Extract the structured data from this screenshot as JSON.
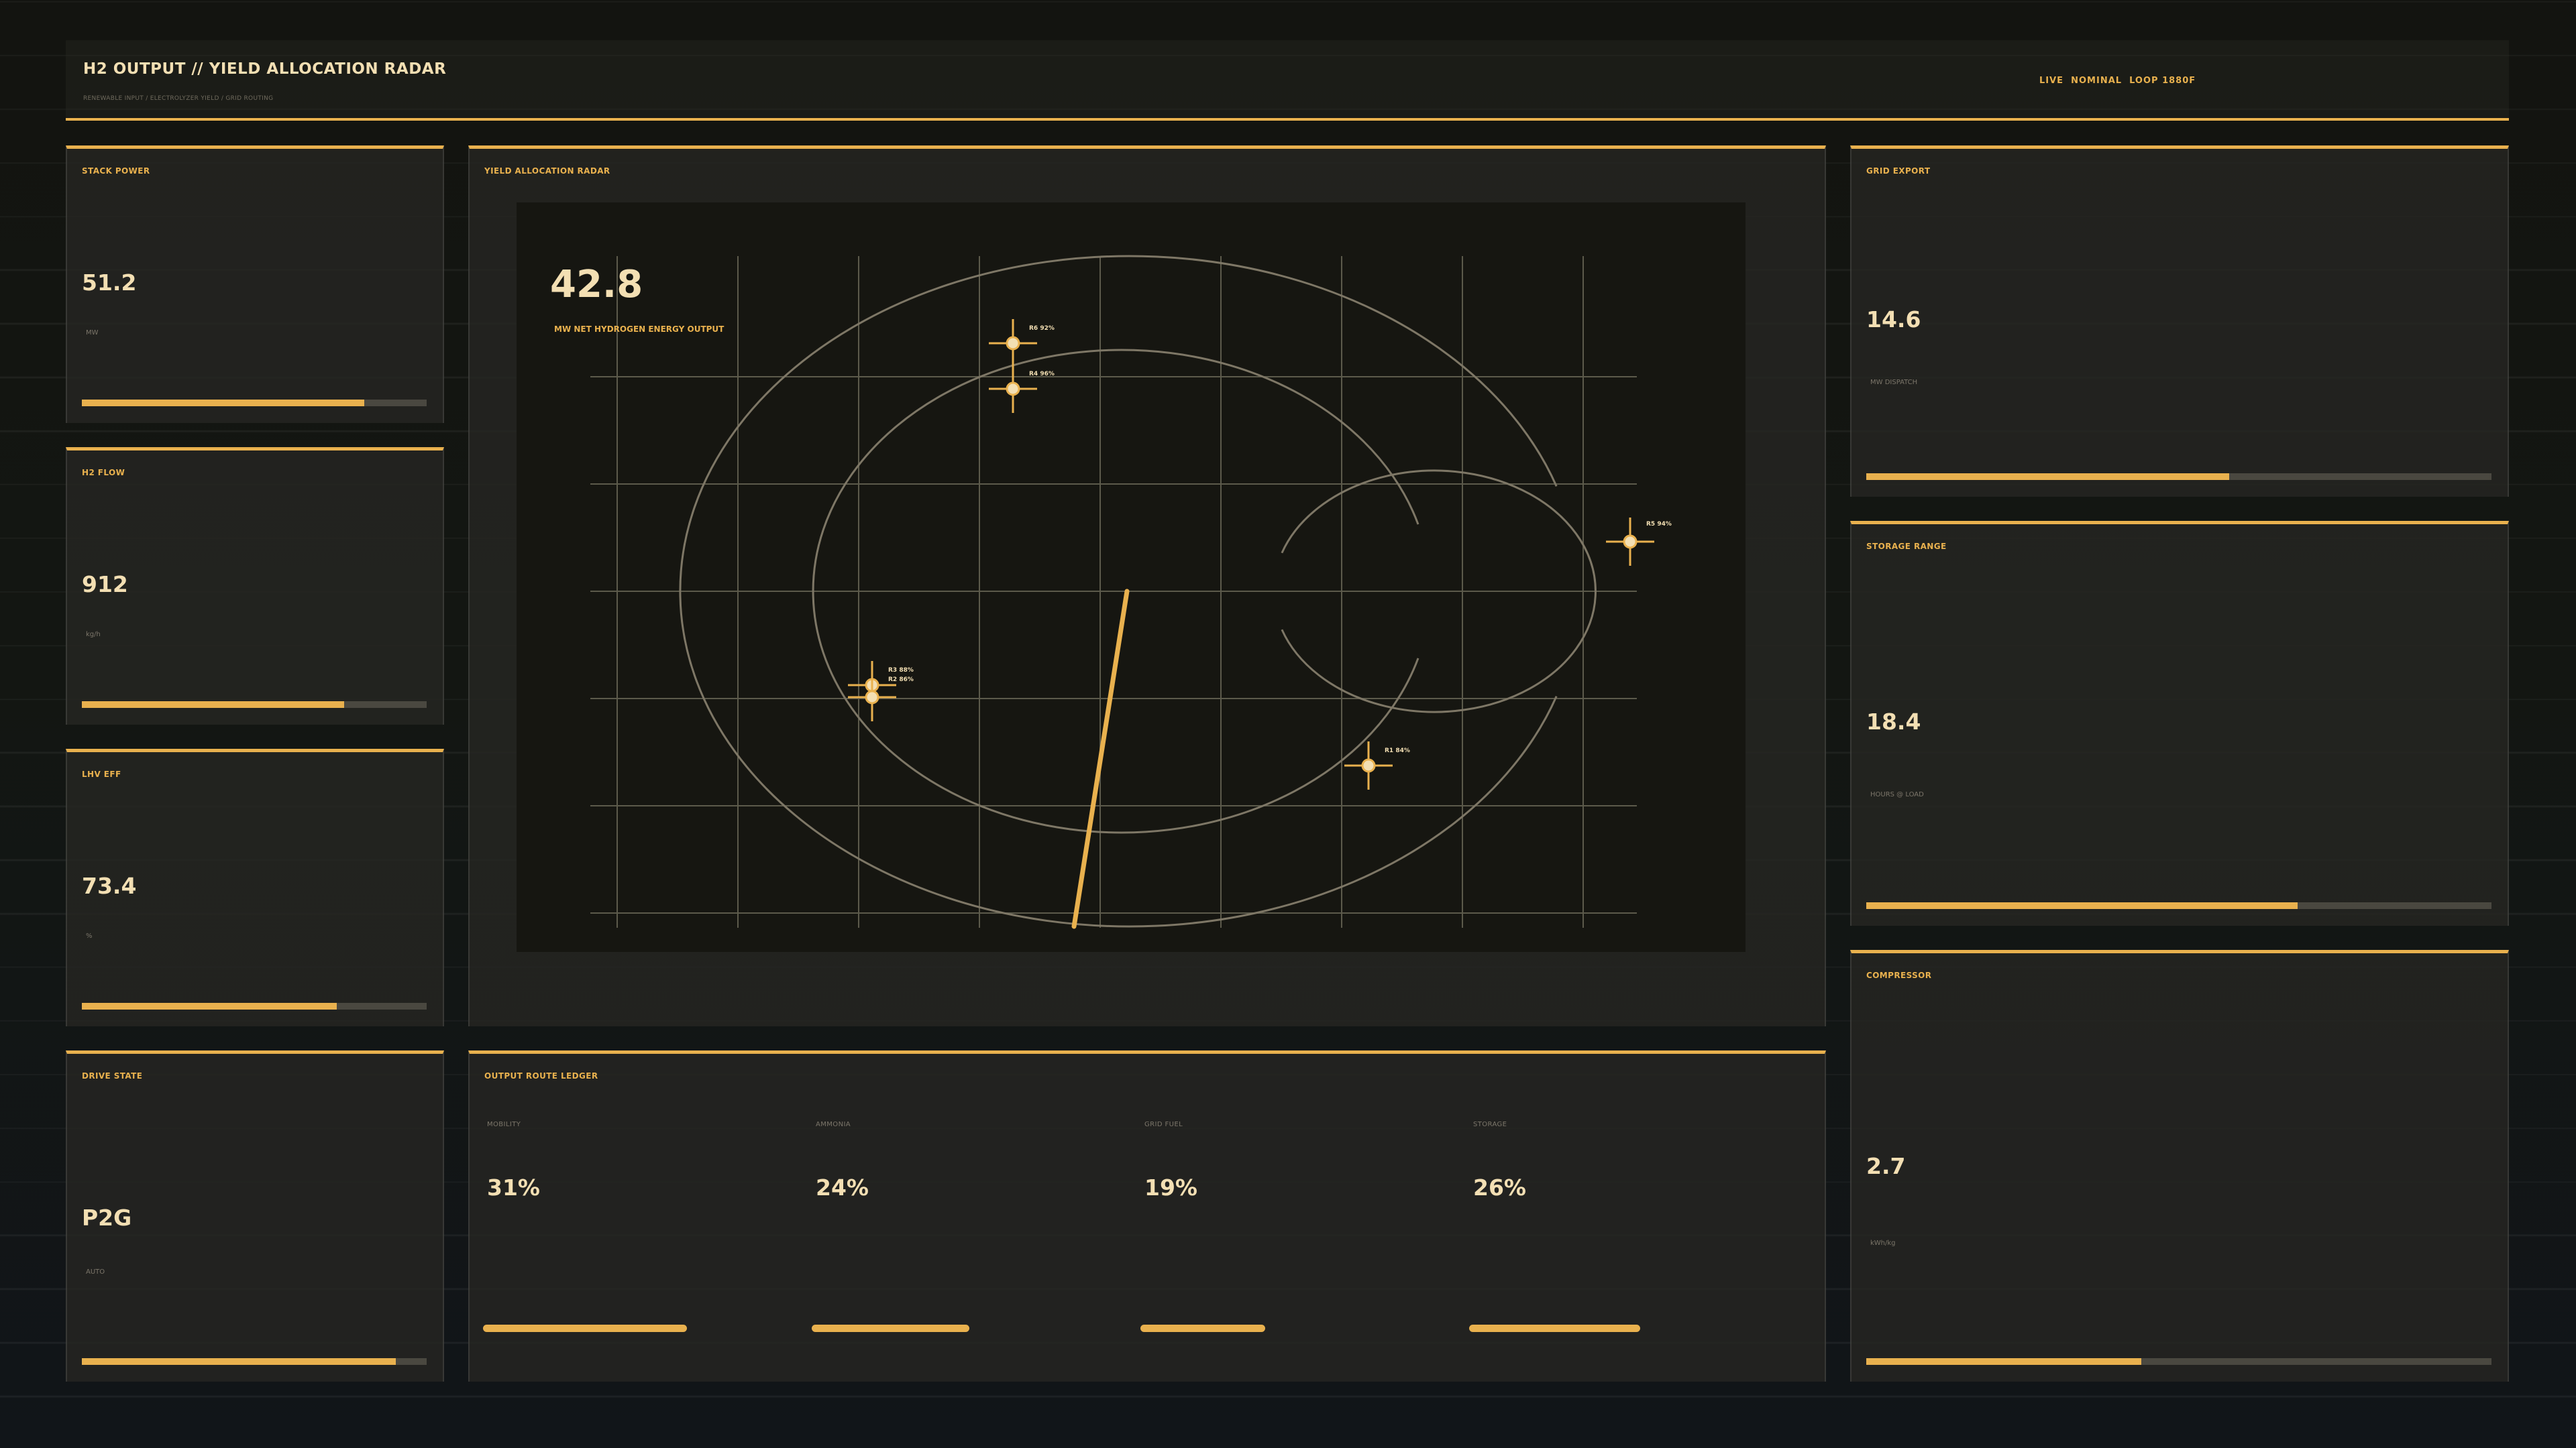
{
  "header": {
    "title": "H2 OUTPUT // YIELD ALLOCATION RADAR",
    "subtitle": "RENEWABLE INPUT / ELECTROLYZER YIELD / GRID ROUTING",
    "status": "LIVE  NOMINAL  LOOP 1880F"
  },
  "left_panels": [
    {
      "title": "STACK POWER",
      "value": "51.2",
      "unit": "MW",
      "fill": 0.82
    },
    {
      "title": "H2 FLOW",
      "value": "912",
      "unit": "kg/h",
      "fill": 0.76
    },
    {
      "title": "LHV EFF",
      "value": "73.4",
      "unit": "%",
      "fill": 0.74
    },
    {
      "title": "DRIVE STATE",
      "value": "P2G",
      "unit": "AUTO",
      "fill": 0.91
    }
  ],
  "radar": {
    "title": "YIELD ALLOCATION RADAR",
    "value": "42.8",
    "caption": "MW NET HYDROGEN ENERGY OUTPUT",
    "blips": [
      {
        "label": "R6 92%"
      },
      {
        "label": "R4 96%"
      },
      {
        "label": "R5 94%"
      },
      {
        "label": "R3 88%"
      },
      {
        "label": "R2 86%"
      },
      {
        "label": "R1 84%"
      }
    ]
  },
  "ledger": {
    "title": "OUTPUT ROUTE LEDGER",
    "routes": [
      {
        "label": "MOBILITY",
        "value": "31%",
        "share": 0.31
      },
      {
        "label": "AMMONIA",
        "value": "24%",
        "share": 0.24
      },
      {
        "label": "GRID FUEL",
        "value": "19%",
        "share": 0.19
      },
      {
        "label": "STORAGE",
        "value": "26%",
        "share": 0.26
      }
    ]
  },
  "right_panels": [
    {
      "title": "GRID EXPORT",
      "value": "14.6",
      "unit": "MW DISPATCH",
      "fill": 0.58
    },
    {
      "title": "STORAGE RANGE",
      "value": "18.4",
      "unit": "HOURS @ LOAD",
      "fill": 0.69
    },
    {
      "title": "COMPRESSOR",
      "value": "2.7",
      "unit": "kWh/kg",
      "fill": 0.44
    }
  ],
  "colors": {
    "accent": "#e9b14e",
    "text": "#f3dfb3",
    "panel": "#262622",
    "muted": "#7c766a"
  }
}
